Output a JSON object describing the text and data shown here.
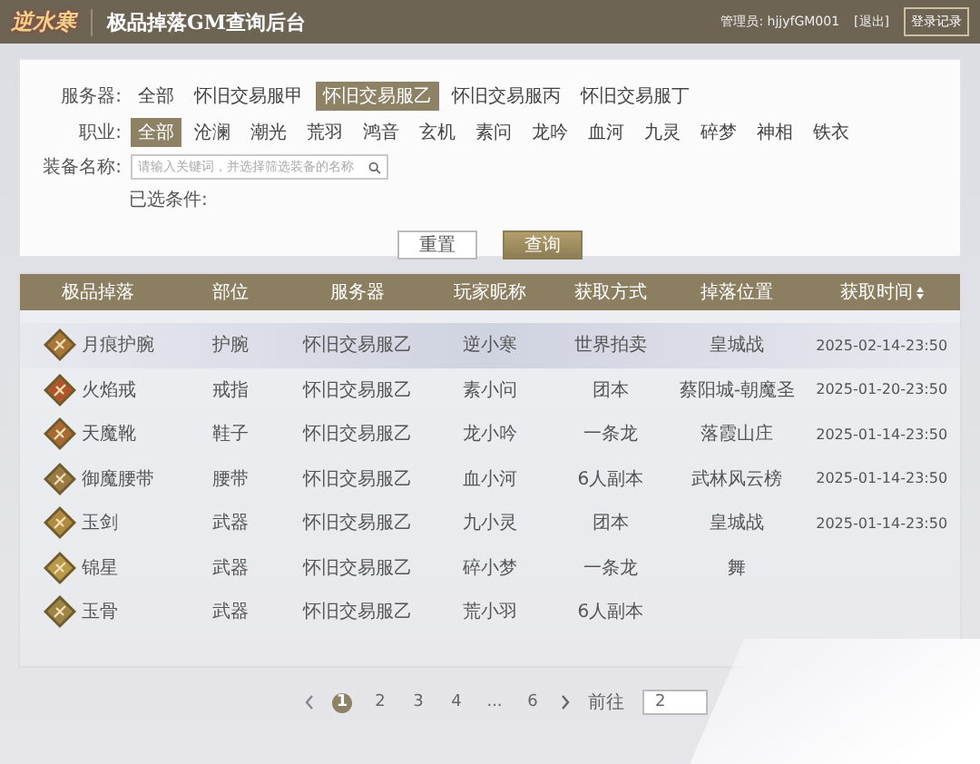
{
  "header": {
    "logo": "逆水寒",
    "title": "极品掉落GM查询后台",
    "admin": "管理员: hjjyfGM001",
    "logout": "[退出]",
    "login_log": "登录记录"
  },
  "filter": {
    "server_label": "服务器:",
    "servers": [
      {
        "label": "全部",
        "selected": false
      },
      {
        "label": "怀旧交易服甲",
        "selected": false
      },
      {
        "label": "怀旧交易服乙",
        "selected": true
      },
      {
        "label": "怀旧交易服丙",
        "selected": false
      },
      {
        "label": "怀旧交易服丁",
        "selected": false
      }
    ],
    "class_label": "职业:",
    "classes": [
      {
        "label": "全部",
        "selected": true
      },
      {
        "label": "沧澜",
        "selected": false
      },
      {
        "label": "潮光",
        "selected": false
      },
      {
        "label": "荒羽",
        "selected": false
      },
      {
        "label": "鸿音",
        "selected": false
      },
      {
        "label": "玄机",
        "selected": false
      },
      {
        "label": "素问",
        "selected": false
      },
      {
        "label": "龙吟",
        "selected": false
      },
      {
        "label": "血河",
        "selected": false
      },
      {
        "label": "九灵",
        "selected": false
      },
      {
        "label": "碎梦",
        "selected": false
      },
      {
        "label": "神相",
        "selected": false
      },
      {
        "label": "铁衣",
        "selected": false
      }
    ],
    "equip_label": "装备名称:",
    "equip_search": {
      "placeholder": "请输入关键词，并选择筛选装备的名称"
    },
    "selected_label": "已选条件:",
    "buttons": [
      "重置",
      "查询"
    ]
  },
  "table": {
    "columns": [
      "极品掉落",
      "部位",
      "服务器",
      "玩家昵称",
      "获取方式",
      "掉落位置",
      "获取时间"
    ],
    "rows": [
      {
        "selected": true,
        "cells": [
          "月痕护腕",
          "护腕",
          "怀旧交易服乙",
          "逆小寒",
          "世界拍卖",
          "皇城战",
          "2025-02-14-23:50"
        ]
      },
      {
        "selected": false,
        "cells": [
          "火焰戒",
          "戒指",
          "怀旧交易服乙",
          "素小问",
          "团本",
          "蔡阳城-朝魔圣",
          "2025-01-20-23:50"
        ]
      },
      {
        "selected": false,
        "cells": [
          "天魔靴",
          "鞋子",
          "怀旧交易服乙",
          "龙小吟",
          "一条龙",
          "落霞山庄",
          "2025-01-14-23:50"
        ]
      },
      {
        "selected": false,
        "cells": [
          "御魔腰带",
          "腰带",
          "怀旧交易服乙",
          "血小河",
          "6人副本",
          "武林风云榜",
          "2025-01-14-23:50"
        ]
      },
      {
        "selected": false,
        "cells": [
          "玉剑",
          "武器",
          "怀旧交易服乙",
          "九小灵",
          "团本",
          "皇城战",
          "2025-01-14-23:50"
        ]
      },
      {
        "selected": false,
        "cells": [
          "锦星",
          "武器",
          "怀旧交易服乙",
          "碎小梦",
          "一条龙",
          "舞"
        ]
      },
      {
        "selected": false,
        "cells": [
          "玉骨",
          "武器",
          "怀旧交易服乙",
          "荒小羽",
          "6人副本"
        ]
      }
    ]
  },
  "pager": {
    "pages": [
      {
        "label": "1",
        "selected": true
      },
      {
        "label": "2",
        "selected": false
      },
      {
        "label": "3",
        "selected": false
      },
      {
        "label": "4",
        "selected": false
      },
      {
        "label": "...",
        "selected": false
      },
      {
        "label": "6",
        "selected": false
      }
    ],
    "goto_label": "前往",
    "goto_value": "2"
  }
}
